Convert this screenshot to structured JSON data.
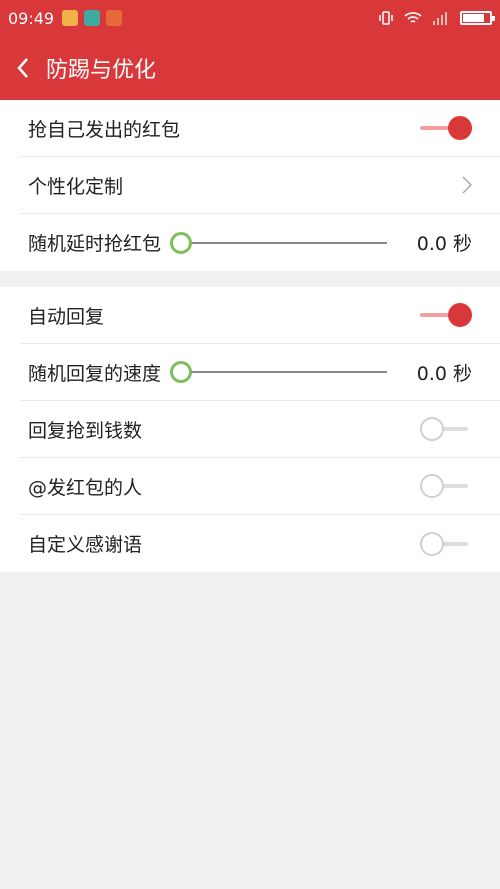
{
  "status": {
    "time": "09:49",
    "battery_level": 0.75
  },
  "appbar": {
    "title": "防踢与优化"
  },
  "section1": {
    "grab_own": {
      "label": "抢自己发出的红包",
      "on": true
    },
    "personalize": {
      "label": "个性化定制"
    },
    "random_delay": {
      "label": "随机延时抢红包",
      "value": "0.0 秒",
      "level": 0
    }
  },
  "section2": {
    "auto_reply": {
      "label": "自动回复",
      "on": true
    },
    "reply_speed": {
      "label": "随机回复的速度",
      "value": "0.0 秒",
      "level": 0
    },
    "reply_amount": {
      "label": "回复抢到钱数",
      "on": false
    },
    "at_sender": {
      "label": "@发红包的人",
      "on": false
    },
    "custom_thanks": {
      "label": "自定义感谢语",
      "on": false
    }
  },
  "colors": {
    "accent": "#d9383a",
    "slider_thumb": "#7dbf5a"
  }
}
